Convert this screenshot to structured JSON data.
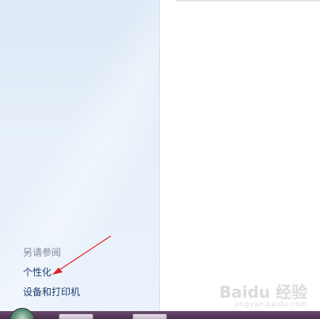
{
  "see_also": {
    "heading": "另请参阅",
    "links": [
      {
        "label": "个性化"
      },
      {
        "label": "设备和打印机"
      }
    ]
  },
  "annotation": {
    "color": "#e02020"
  },
  "watermark": {
    "main": "Baidu 经验",
    "sub": "jingyan.baidu.com"
  },
  "taskbar": {
    "color": "#4b2e4f"
  }
}
